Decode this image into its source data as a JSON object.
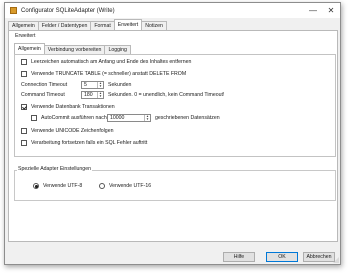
{
  "window": {
    "title": "Configurator SQLiteAdapter (Write)",
    "minimize_glyph": "—",
    "close_glyph": "✕",
    "icon": "config-app-icon"
  },
  "outer_tabs": [
    {
      "label": "Allgemein",
      "active": false
    },
    {
      "label": "Felder / Datentypen",
      "active": false
    },
    {
      "label": "Format",
      "active": false
    },
    {
      "label": "Erweitert",
      "active": true
    },
    {
      "label": "Notizen",
      "active": false
    }
  ],
  "extended_group_label": "Erweitert",
  "inner_tabs": [
    {
      "label": "Allgemein",
      "active": true
    },
    {
      "label": "Verbindung vorbereiten",
      "active": false
    },
    {
      "label": "Logging",
      "active": false
    }
  ],
  "options": {
    "trim_spaces": {
      "label": "Leerzeichen automatisch am Anfang und Ende des Inhaltes entfernen",
      "checked": false
    },
    "truncate": {
      "label": "Verwende TRUNCATE TABLE (= schneller) anstatt DELETE FROM",
      "checked": false
    },
    "connection_timeout": {
      "label": "Connection Timeout",
      "value": "5",
      "unit": "Sekunden"
    },
    "command_timeout": {
      "label": "Command Timeout",
      "value": "180",
      "unit": "Sekunden. 0 = unendlich, kein Command Timeout!"
    },
    "transactions": {
      "label": "Verwende Datenbank Transaktionen",
      "checked": true
    },
    "autocommit": {
      "label": "AutoCommit ausführen nach",
      "checked": false,
      "value": "10000",
      "unit": "geschriebenen Datensätzen"
    },
    "unicode": {
      "label": "Verwende UNICODE Zeichenfolgen",
      "checked": false
    },
    "continue_on_error": {
      "label": "Verarbeitung fortsetzen falls ein SQL Fehler auftritt",
      "checked": false
    }
  },
  "special": {
    "group_label": "Spezielle Adapter Einstellungen",
    "utf8_label": "Verwende UTF-8",
    "utf16_label": "Verwende UTF-16",
    "selected": "utf8"
  },
  "buttons": {
    "help": "Hilfe",
    "ok": "OK",
    "cancel": "Abbrechen"
  },
  "spin_glyphs": {
    "up": "▲",
    "down": "▼"
  }
}
